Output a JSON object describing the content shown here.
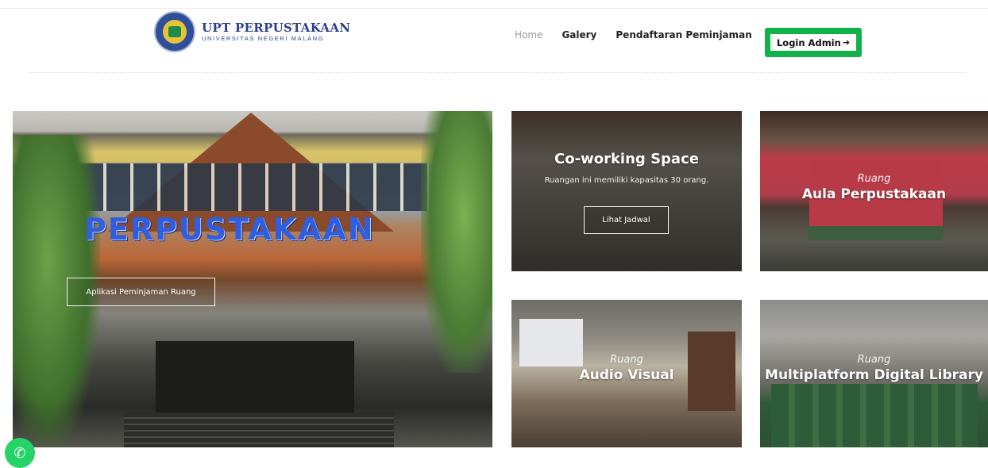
{
  "brand": {
    "title": "UPT PERPUSTAKAAN",
    "subtitle": "UNIVERSITAS NEGERI MALANG",
    "logo": "unm-seal-icon"
  },
  "nav": {
    "items": [
      {
        "label": "Home",
        "active": true
      },
      {
        "label": "Galery",
        "active": false
      },
      {
        "label": "Pendaftaran Peminjaman",
        "active": false
      }
    ],
    "login_label": "Login Admin",
    "login_icon": "sign-in-icon",
    "login_color": "#11b24a"
  },
  "hero": {
    "sign_text": "PERPUSTAKAAN",
    "button_label": "Aplikasi Peminjaman Ruang",
    "sign_color": "#2f5fe0"
  },
  "cards": [
    {
      "label": "",
      "title": "Co-working Space",
      "description": "Ruangan ini memiliki kapasitas 30 orang.",
      "button_label": "Lihat Jadwal"
    },
    {
      "label": "Ruang",
      "title": "Aula Perpustakaan"
    },
    {
      "label": "Ruang",
      "title": "Audio Visual"
    },
    {
      "label": "Ruang",
      "title": "Multiplatform Digital Library"
    }
  ],
  "whatsapp": {
    "icon": "whatsapp-icon",
    "color": "#25d366"
  }
}
